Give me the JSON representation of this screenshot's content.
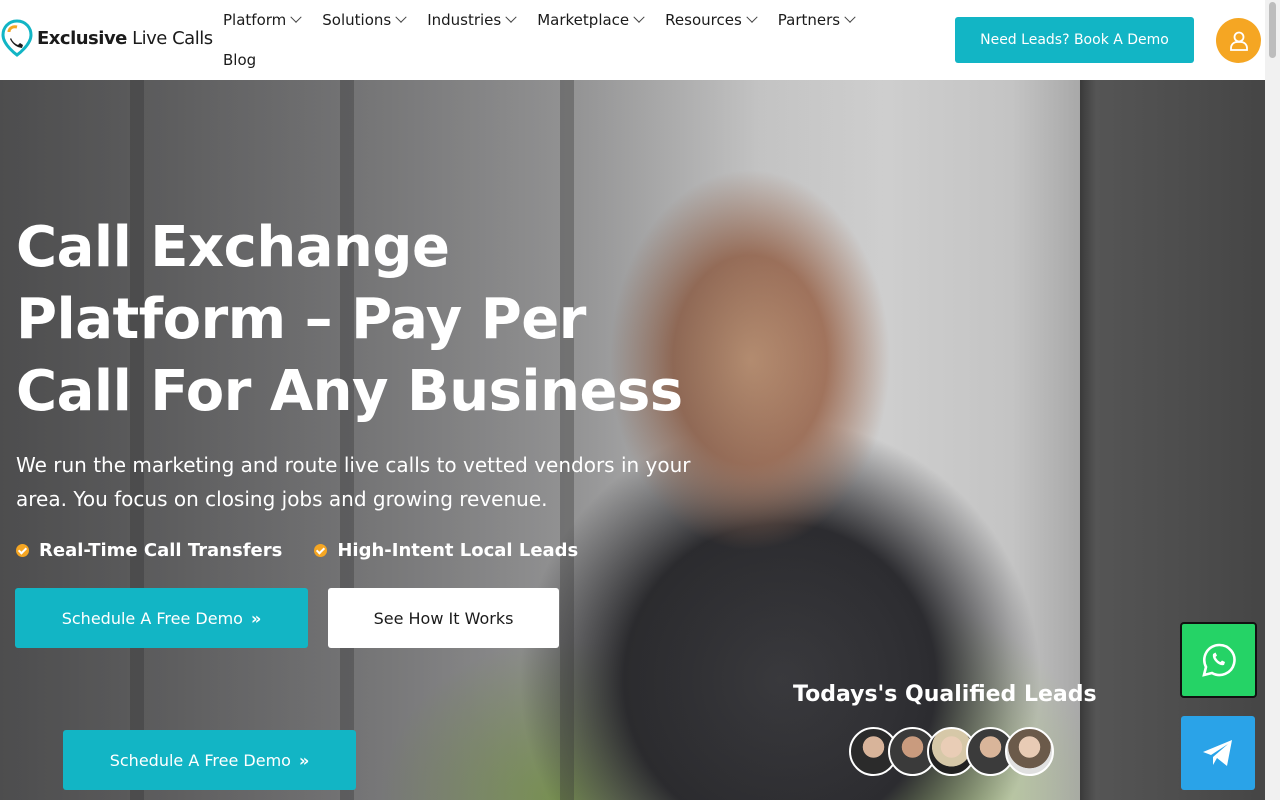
{
  "brand": {
    "name_bold": "Exclusive",
    "name_light": " Live Calls",
    "colors": {
      "accent": "#12b5c5",
      "orange": "#f5a623",
      "whatsapp": "#25d366",
      "telegram": "#2aa3e8"
    }
  },
  "nav": {
    "items": [
      {
        "label": "Platform"
      },
      {
        "label": "Solutions"
      },
      {
        "label": "Industries"
      },
      {
        "label": "Marketplace"
      },
      {
        "label": "Resources"
      },
      {
        "label": "Partners"
      }
    ],
    "blog": "Blog"
  },
  "header": {
    "cta": "Need Leads? Book A Demo",
    "user_icon": "user-icon"
  },
  "hero": {
    "title": "Call Exchange Platform – Pay Per Call For Any Business",
    "subtitle": "We run the marketing and route live calls to vetted vendors in your area. You focus on closing jobs and growing revenue.",
    "bullets": [
      "Real-Time Call Transfers",
      "High-Intent Local Leads"
    ],
    "primary_cta": "Schedule A Free Demo",
    "secondary_cta": "See How It Works",
    "sticky_cta": "Schedule A Free Demo",
    "arrows": "»",
    "leads_title": "Todays's Qualified Leads"
  },
  "floating": {
    "whatsapp_icon": "whatsapp-icon",
    "telegram_icon": "telegram-icon"
  }
}
